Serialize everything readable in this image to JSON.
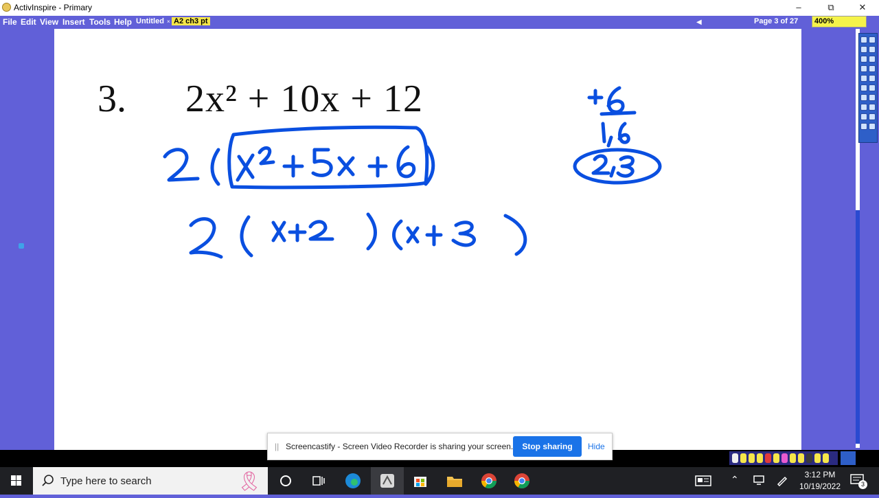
{
  "window": {
    "title": "ActivInspire - Primary",
    "minimize": "–",
    "restore": "⧉",
    "close": "✕"
  },
  "menu": {
    "items": [
      "File",
      "Edit",
      "View",
      "Insert",
      "Tools",
      "Help"
    ],
    "doc_untitled": "Untitled",
    "doc_active": "A2 ch3 pt",
    "page_indicator": "Page 3 of 27",
    "zoom": "400%"
  },
  "canvas": {
    "problem_number": "3.",
    "problem_expression": "2x² + 10x + 12"
  },
  "share_bar": {
    "handle": "||",
    "text": "Screencastify - Screen Video Recorder is sharing your screen.",
    "stop_label": "Stop sharing",
    "hide_label": "Hide"
  },
  "taskbar": {
    "search_placeholder": "Type here to search",
    "time": "3:12 PM",
    "date": "10/19/2022",
    "notification_count": "3"
  },
  "colors": {
    "app_frame": "#6160d8",
    "ink": "#0a4fe0",
    "zoom_box": "#f5f34a",
    "stop_button": "#1a73e8"
  },
  "icons": [
    "activinspire-icon",
    "windows-start-icon",
    "search-icon",
    "cortana-icon",
    "task-view-icon",
    "edge-icon",
    "activinspire-taskbar-icon",
    "store-icon",
    "file-explorer-icon",
    "chrome-icon",
    "chrome-icon-2",
    "news-icon",
    "chevron-up-icon",
    "network-icon",
    "pen-icon",
    "notification-icon"
  ]
}
